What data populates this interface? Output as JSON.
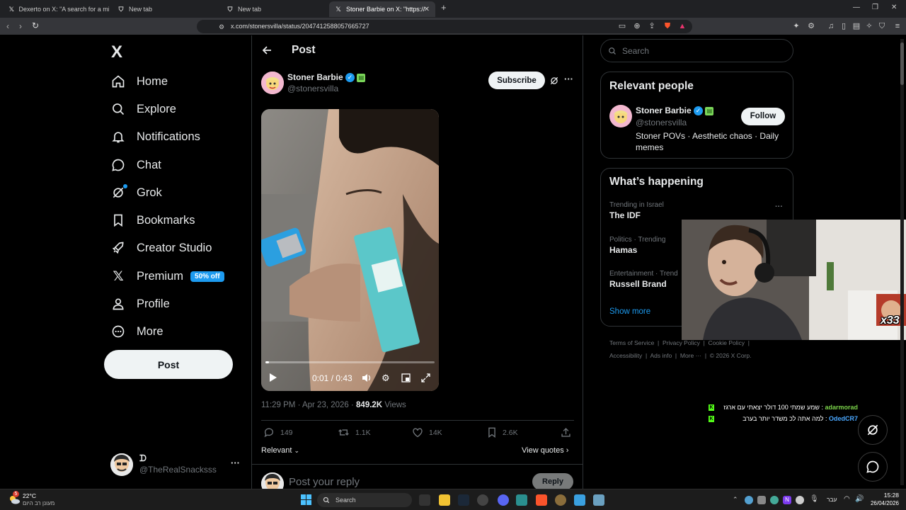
{
  "browser": {
    "tabs": [
      {
        "label": "Dexerto on X: \"A search for a missing",
        "icon": "x-logo-icon"
      },
      {
        "label": "New tab",
        "icon": "shield-icon"
      },
      {
        "label": "New tab",
        "icon": "shield-icon"
      },
      {
        "label": "Stoner Barbie on X: \"https://t.co/",
        "icon": "x-logo-icon",
        "active": true
      }
    ],
    "url": "x.com/stonersvilla/status/2047412588057665727",
    "new_tab": "+"
  },
  "sidebar": {
    "logo": "X",
    "items": [
      {
        "label": "Home",
        "icon": "home-icon"
      },
      {
        "label": "Explore",
        "icon": "search-icon"
      },
      {
        "label": "Notifications",
        "icon": "bell-icon"
      },
      {
        "label": "Chat",
        "icon": "chat-icon"
      },
      {
        "label": "Grok",
        "icon": "grok-icon"
      },
      {
        "label": "Bookmarks",
        "icon": "bookmark-icon"
      },
      {
        "label": "Creator Studio",
        "icon": "rocket-icon"
      },
      {
        "label": "Premium",
        "icon": "x-logo-icon",
        "badge": "50% off"
      },
      {
        "label": "Profile",
        "icon": "person-icon"
      },
      {
        "label": "More",
        "icon": "more-circle-icon"
      }
    ],
    "post_button": "Post",
    "account": {
      "name": "ᗪ",
      "handle": "@TheRealSnacksss",
      "more": "···"
    }
  },
  "post": {
    "header_title": "Post",
    "author": {
      "name": "Stoner Barbie",
      "handle": "@stonersvilla"
    },
    "subscribe": "Subscribe",
    "video": {
      "time": "0:01 / 0:43",
      "progress": 0.02
    },
    "timestamp": "11:29 PM · Apr 23, 2026 · ",
    "views_count": "849.2K",
    "views_label": " Views",
    "actions": {
      "replies": "149",
      "reposts": "1.1K",
      "likes": "14K",
      "bookmarks": "2.6K"
    },
    "relevant": "Relevant",
    "view_quotes": "View quotes",
    "reply_placeholder": "Post your reply",
    "reply_button": "Reply"
  },
  "right": {
    "search_placeholder": "Search",
    "relevant_people": {
      "title": "Relevant people",
      "name": "Stoner Barbie",
      "handle": "@stonersvilla",
      "bio": "Stoner POVs · Aesthetic chaos · Daily memes",
      "follow": "Follow"
    },
    "happening": {
      "title": "What’s happening",
      "trends": [
        {
          "context": "Trending in Israel",
          "title": "The IDF"
        },
        {
          "context": "Politics · Trending",
          "title": "Hamas"
        },
        {
          "context": "Entertainment · Trend",
          "title": "Russell Brand"
        }
      ],
      "show_more": "Show more"
    },
    "footer": {
      "row1": [
        "Terms of Service",
        "Privacy Policy",
        "Cookie Policy"
      ],
      "row2": [
        "Accessibility",
        "Ads info",
        "More ···",
        "© 2026 X Corp."
      ]
    }
  },
  "overlay": {
    "sticker_text": "x33",
    "chat": [
      {
        "user": "adarmorad",
        "text": "שמע שמתי 100 דולר יצאתי עם ארגז",
        "user_color": "#7bd34a"
      },
      {
        "user": "OdedCR7",
        "text": "למה אתה לכ משדר יותר בערב",
        "user_color": "#4aa8ff"
      }
    ]
  },
  "taskbar": {
    "weather_temp": "22°C",
    "weather_desc": "מעונן רב היום",
    "weather_badge": "5",
    "search": "Search",
    "lang": "עבר",
    "time": "15:28",
    "date": "26/04/2026"
  }
}
